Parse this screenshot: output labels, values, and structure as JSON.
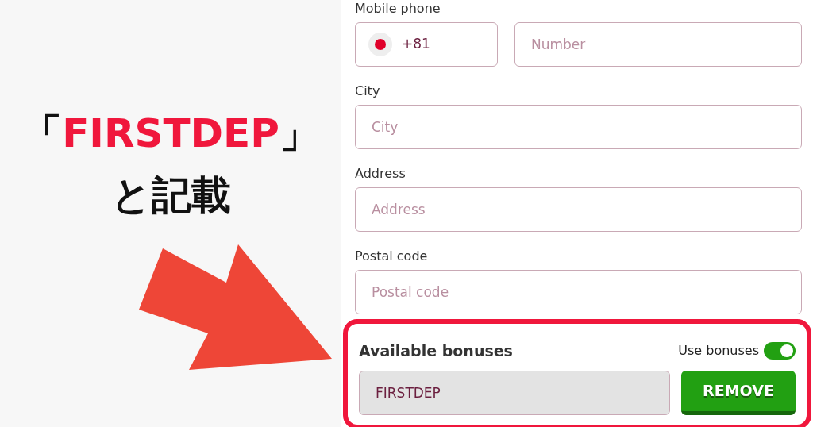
{
  "annotation": {
    "open_bracket": "「",
    "highlight": "FIRSTDEP",
    "close_bracket": "」",
    "line_2": "と記載"
  },
  "form": {
    "fields": [
      {
        "kind": "phone",
        "label": "Mobile phone",
        "code": "+81",
        "placeholder": "Number"
      },
      {
        "kind": "text",
        "label": "City",
        "placeholder": "City"
      },
      {
        "kind": "text",
        "label": "Address",
        "placeholder": "Address"
      },
      {
        "kind": "text",
        "label": "Postal code",
        "placeholder": "Postal code"
      }
    ]
  },
  "bonuses": {
    "title": "Available bonuses",
    "toggle_label": "Use bonuses",
    "on": true,
    "code": "FIRSTDEP",
    "button": "REMOVE"
  }
}
